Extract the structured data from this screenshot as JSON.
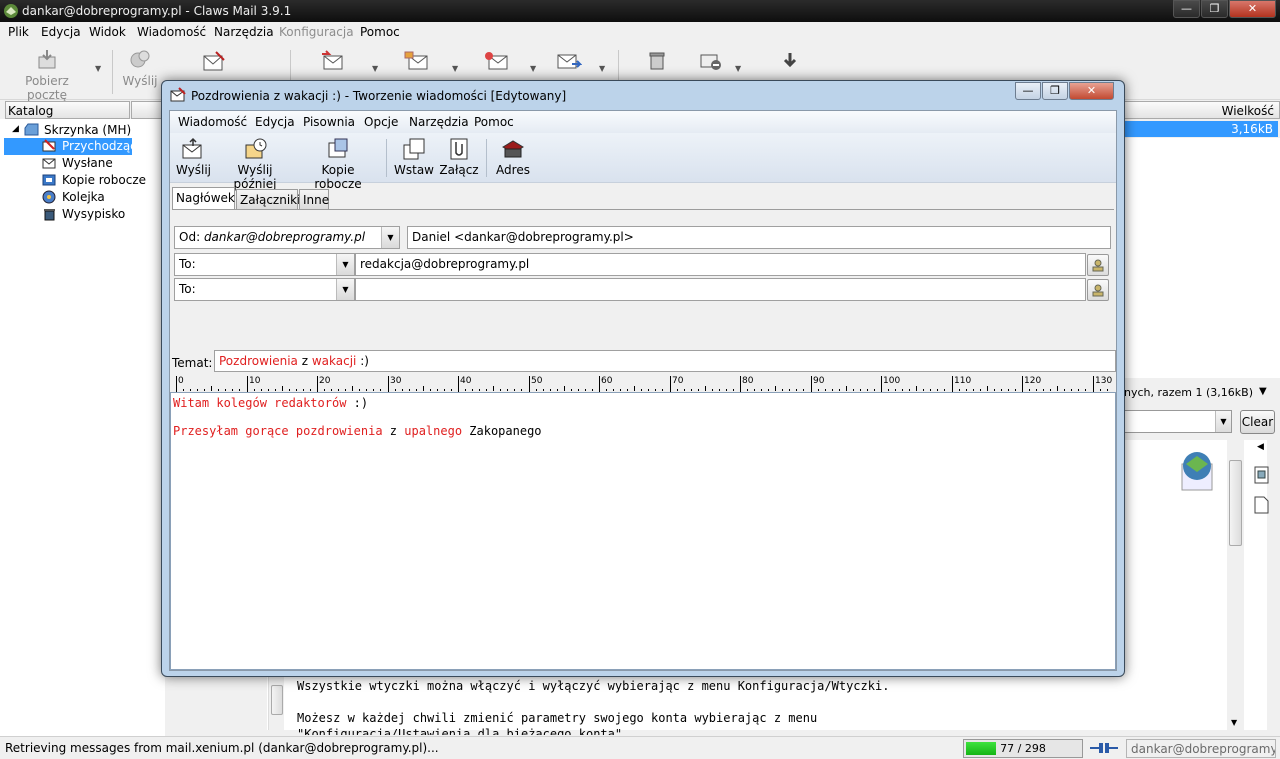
{
  "window": {
    "title": "dankar@dobreprogramy.pl - Claws Mail 3.9.1",
    "controls": {
      "minimize": "—",
      "restore": "❐",
      "close": "✕"
    }
  },
  "menu": {
    "items": [
      "Plik",
      "Edycja",
      "Widok",
      "Wiadomość",
      "Narzędzia",
      "Konfiguracja",
      "Pomoc"
    ]
  },
  "toolbar": {
    "get_mail": "Pobierz pocztę",
    "send": "Wyślij"
  },
  "folders": {
    "header": "Katalog",
    "items": [
      {
        "label": "Skrzynka (MH)",
        "icon": "mailbox-icon"
      },
      {
        "label": "Przychodzące",
        "icon": "inbox-icon"
      },
      {
        "label": "Wysłane",
        "icon": "sent-icon"
      },
      {
        "label": "Kopie robocze",
        "icon": "drafts-icon"
      },
      {
        "label": "Kolejka",
        "icon": "queue-icon"
      },
      {
        "label": "Wysypisko",
        "icon": "trash-icon"
      }
    ]
  },
  "message_list": {
    "size_header": "Wielkość",
    "rows": [
      {
        "size": "3,16kB"
      }
    ],
    "summary": "nych, razem 1 (3,16kB)",
    "clear_label": "Clear"
  },
  "viewer": {
    "lines": [
      "Wszystkie wtyczki można włączyć i wyłączyć wybierając z menu Konfiguracja/Wtyczki.",
      "Możesz w każdej chwili zmienić parametry swojego konta wybierając z menu",
      "\"Konfiguracja/Ustawienia dla bieżącego konta\"."
    ]
  },
  "status": {
    "message": "Retrieving messages from mail.xenium.pl (dankar@dobreprogramy.pl)...",
    "progress_text": "77 / 298",
    "progress_fraction": 0.258,
    "account": "dankar@dobreprogramy.pl"
  },
  "compose": {
    "title": "Pozdrowienia z wakacji :) - Tworzenie wiadomości  [Edytowany]",
    "menu": [
      "Wiadomość",
      "Edycja",
      "Pisownia",
      "Opcje",
      "Narzędzia",
      "Pomoc"
    ],
    "toolbar": {
      "send": "Wyślij",
      "send_later": "Wyślij później",
      "drafts": "Kopie robocze",
      "insert": "Wstaw",
      "attach": "Załącz",
      "address": "Adres"
    },
    "tabs": [
      "Nagłówek",
      "Załączniki",
      "Inne"
    ],
    "from_label": "Od:",
    "from_account": "dankar@dobreprogramy.pl",
    "from_value": "Daniel <dankar@dobreprogramy.pl>",
    "recipients": [
      {
        "type": "To:",
        "value": "redakcja@dobreprogramy.pl"
      },
      {
        "type": "To:",
        "value": ""
      }
    ],
    "subject_label": "Temat:",
    "subject_words": [
      "Pozdrowienia",
      " z ",
      "wakacji",
      " :)"
    ],
    "ruler_labels": [
      "0",
      "10",
      "20",
      "30",
      "40",
      "50",
      "60",
      "70",
      "80",
      "90",
      "100",
      "110",
      "120",
      "130"
    ],
    "body_line1": [
      "Witam",
      " ",
      "kolegów",
      " ",
      "redaktorów",
      " :)"
    ],
    "body_line2": [
      "Przesyłam",
      " ",
      "gorące",
      " ",
      "pozdrowienia",
      " z ",
      "upalnego",
      " Zakopanego"
    ]
  }
}
